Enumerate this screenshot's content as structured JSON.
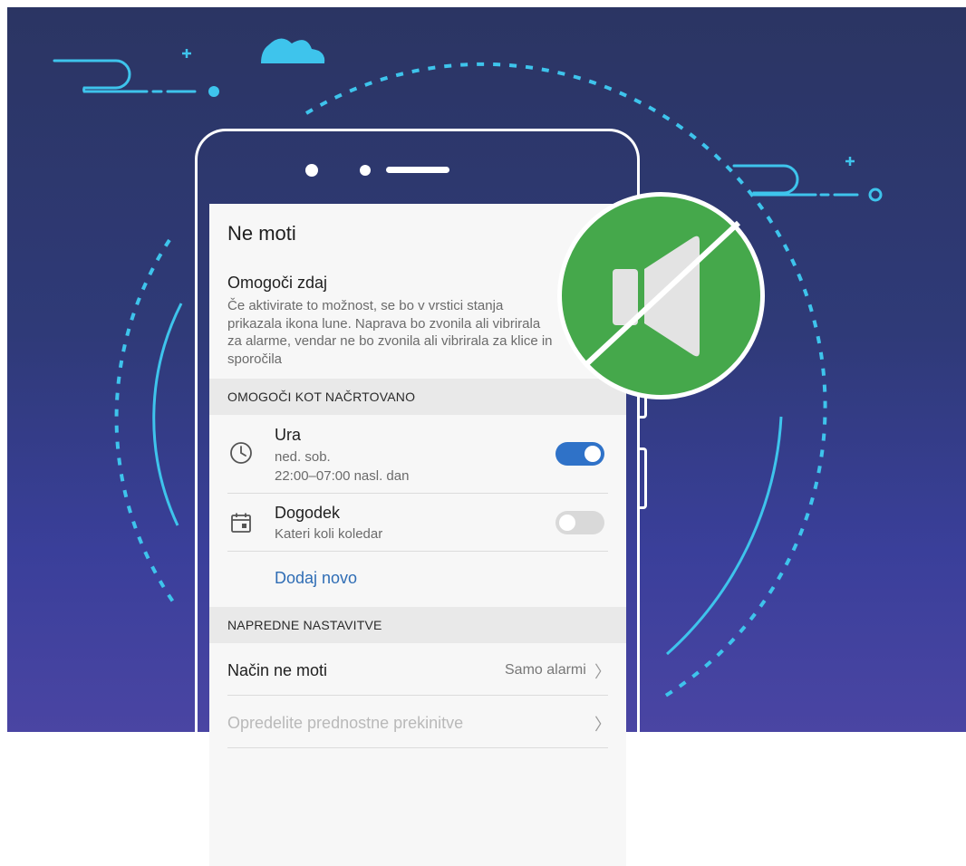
{
  "screen": {
    "title": "Ne moti",
    "enable_now": {
      "title": "Omogoči zdaj",
      "description": "Če aktivirate to možnost, se bo v vrstici stanja prikazala ikona lune. Naprava bo zvonila ali vibrirala za alarme, vendar ne bo zvonila ali vibrirala za klice in sporočila"
    },
    "scheduled_header": "OMOGOČI KOT NAČRTOVANO",
    "rules": [
      {
        "title": "Ura",
        "days": "ned. sob.",
        "time": "22:00–07:00 nasl. dan",
        "icon": "clock-icon",
        "enabled": true
      },
      {
        "title": "Dogodek",
        "subtitle": "Kateri koli koledar",
        "icon": "calendar-icon",
        "enabled": false
      }
    ],
    "add_new": "Dodaj novo",
    "advanced_header": "NAPREDNE NASTAVITVE",
    "mode": {
      "label": "Način ne moti",
      "value": "Samo alarmi"
    },
    "priority": {
      "label": "Opredelite prednostne prekinitve"
    }
  },
  "colors": {
    "background_top": "#2b3563",
    "background_bottom": "#4a45a3",
    "accent_blue": "#2f72c8",
    "badge_green": "#45a84b",
    "deco_line": "#3ec4ec"
  },
  "icons": [
    "clock-icon",
    "calendar-icon",
    "chevron-right-icon",
    "muted-speaker-icon",
    "cloud-icon"
  ]
}
